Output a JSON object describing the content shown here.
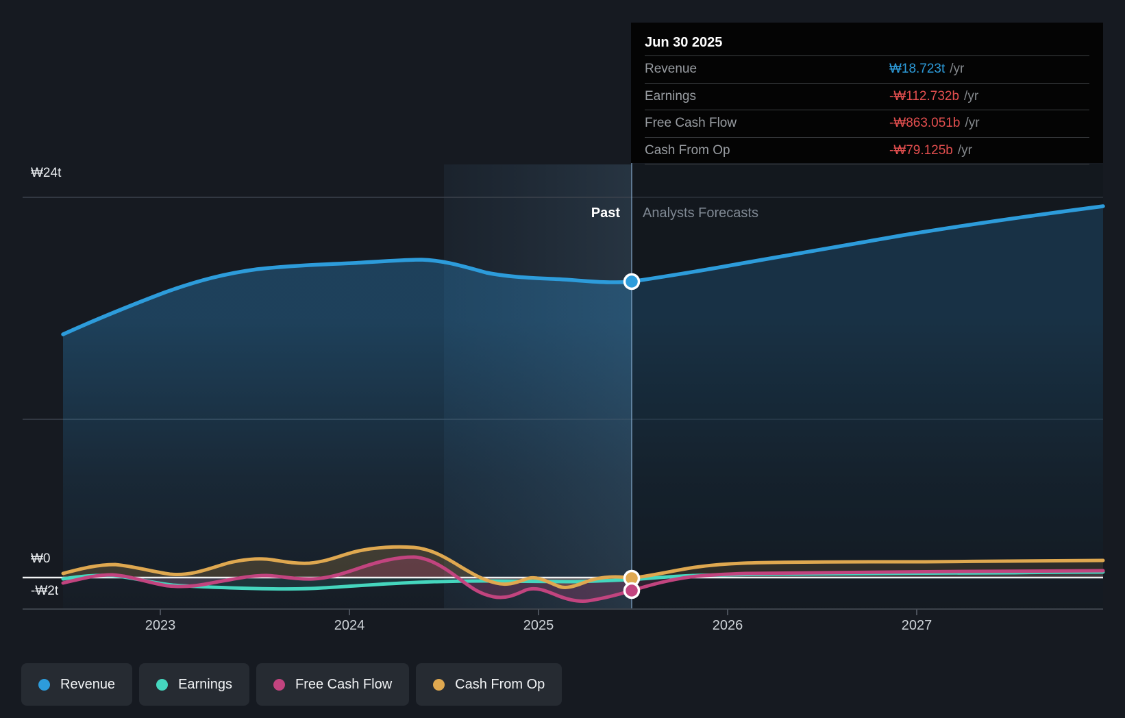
{
  "chart": {
    "y_axis_labels": [
      "₩24t",
      "₩0",
      "-₩2t"
    ],
    "x_axis_years": [
      "2023",
      "2024",
      "2025",
      "2026",
      "2027"
    ],
    "past_label": "Past",
    "forecasts_label": "Analysts Forecasts",
    "divider_date": "Jun 30 2025"
  },
  "tooltip": {
    "title": "Jun 30 2025",
    "rows": [
      {
        "label": "Revenue",
        "value": "₩18.723t",
        "suffix": "/yr",
        "value_color": "#2d9cdb"
      },
      {
        "label": "Earnings",
        "value": "-₩112.732b",
        "suffix": "/yr",
        "value_color": "#e44f4f"
      },
      {
        "label": "Free Cash Flow",
        "value": "-₩863.051b",
        "suffix": "/yr",
        "value_color": "#e44f4f"
      },
      {
        "label": "Cash From Op",
        "value": "-₩79.125b",
        "suffix": "/yr",
        "value_color": "#e44f4f"
      }
    ]
  },
  "legend": {
    "items": [
      {
        "label": "Revenue",
        "color": "#2d9cdb"
      },
      {
        "label": "Earnings",
        "color": "#45d6be"
      },
      {
        "label": "Free Cash Flow",
        "color": "#c2447f"
      },
      {
        "label": "Cash From Op",
        "color": "#dfa850"
      }
    ]
  },
  "colors": {
    "background": "#161a21",
    "tooltip_background": "#040404",
    "gridline": "#3c434d",
    "zero_line": "#f2f4f5",
    "divider_line": "#8fb6d9",
    "revenue": "#2d9cdb",
    "earnings": "#45d6be",
    "free_cash_flow": "#c2447f",
    "cash_from_op": "#dfa850",
    "negative_value": "#e44f4f"
  },
  "chart_data": {
    "type": "area",
    "title": "",
    "unit": "KRW trillions per year",
    "x": [
      "2022-06",
      "2023-01",
      "2023-07",
      "2024-01",
      "2024-04",
      "2024-07",
      "2025-01",
      "2025-06-30",
      "2026-01",
      "2027-01",
      "2027-12"
    ],
    "series": [
      {
        "name": "Revenue",
        "values": [
          15.5,
          18.0,
          19.5,
          19.9,
          20.1,
          19.9,
          19.0,
          18.723,
          19.8,
          21.8,
          23.4
        ]
      },
      {
        "name": "Earnings",
        "values": [
          -0.09,
          -0.52,
          -0.69,
          -0.65,
          -0.5,
          -0.39,
          -0.22,
          -0.113,
          0.13,
          0.26,
          0.35
        ]
      },
      {
        "name": "Free Cash Flow",
        "values": [
          -0.35,
          -0.52,
          0.09,
          0.45,
          1.3,
          0.56,
          -1.0,
          -0.863,
          0.22,
          0.35,
          0.43
        ]
      },
      {
        "name": "Cash From Op",
        "values": [
          0.26,
          0.22,
          1.08,
          1.65,
          1.95,
          1.0,
          -0.13,
          -0.079,
          0.87,
          1.0,
          1.08
        ]
      }
    ],
    "xlabel": "",
    "ylabel": "",
    "ylim_trillions": [
      -2,
      25
    ],
    "gridlines_at_trillions": [
      24,
      10
    ],
    "zero_line": true,
    "past_forecast_divider_x": "2025-06-30",
    "highlight_band_x": [
      "2024-07",
      "2025-06-30"
    ],
    "legend_position": "bottom-left"
  }
}
